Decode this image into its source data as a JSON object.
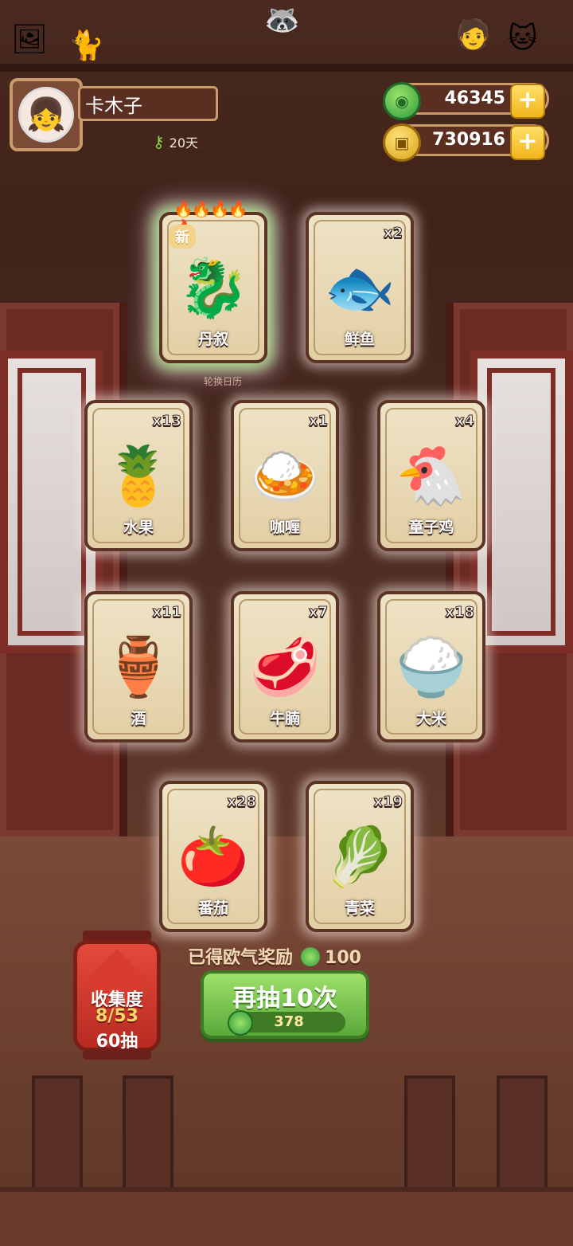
{
  "player": {
    "name": "卡木子",
    "days": "20天"
  },
  "currency": {
    "jade": "46345",
    "gold": "730916"
  },
  "rotate_label": "轮换日历",
  "cards": [
    {
      "label": "丹叙",
      "count": "",
      "icon": "dragon-figure",
      "rare": true,
      "tag": "新",
      "art": "🐉"
    },
    {
      "label": "鲜鱼",
      "count": "x2",
      "icon": "fish",
      "art": "🐟"
    },
    {
      "label": "水果",
      "count": "x13",
      "icon": "fruit",
      "art": "🍍"
    },
    {
      "label": "咖喱",
      "count": "x1",
      "icon": "curry-boat",
      "art": "🍛"
    },
    {
      "label": "童子鸡",
      "count": "x4",
      "icon": "chicken",
      "art": "🐔"
    },
    {
      "label": "酒",
      "count": "x11",
      "icon": "wine-jar",
      "art": "🏺"
    },
    {
      "label": "牛腩",
      "count": "x7",
      "icon": "beef",
      "art": "🥩"
    },
    {
      "label": "大米",
      "count": "x18",
      "icon": "rice-bowl",
      "art": "🍚"
    },
    {
      "label": "番茄",
      "count": "x28",
      "icon": "tomato",
      "art": "🍅"
    },
    {
      "label": "青菜",
      "count": "x19",
      "icon": "greens",
      "art": "🥬"
    }
  ],
  "reward": {
    "text": "已得欧气奖励",
    "amount": "100"
  },
  "draw_button": {
    "label": "再抽10次",
    "cost": "378"
  },
  "collection": {
    "title": "收集度",
    "progress": "8/53",
    "draws": "60抽"
  }
}
